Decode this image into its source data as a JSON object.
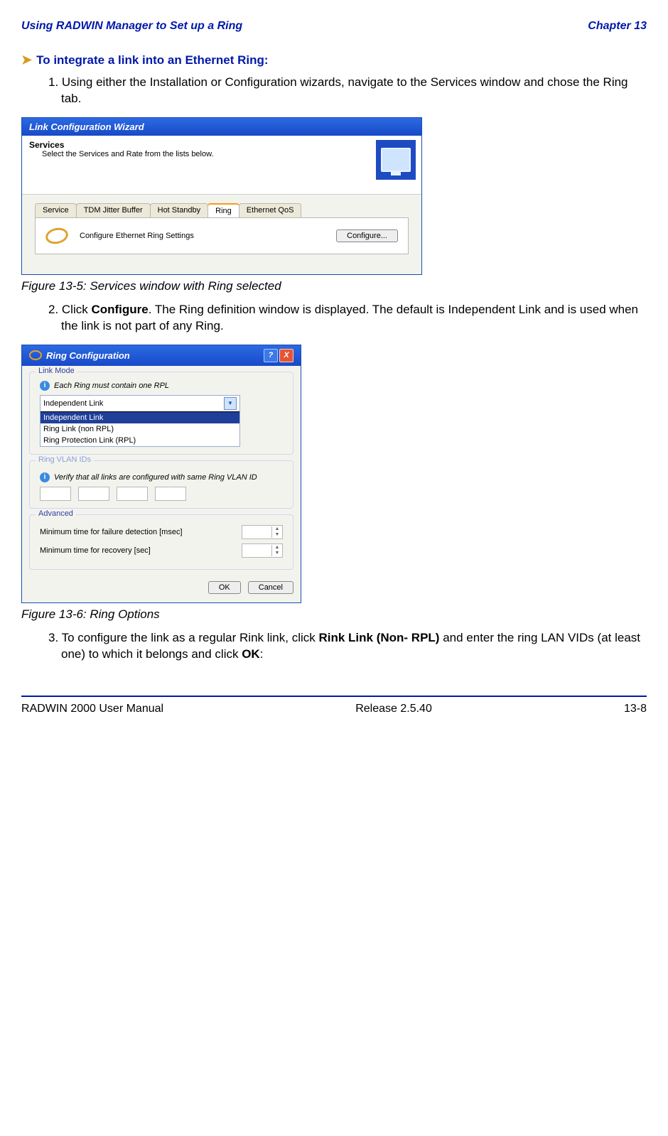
{
  "header": {
    "left": "Using RADWIN Manager to Set up a Ring",
    "right": "Chapter 13"
  },
  "section": {
    "title": "To integrate a link into an Ethernet Ring:"
  },
  "steps": {
    "s1": "1. Using either the Installation or Configuration wizards, navigate to the Services window and chose the Ring tab.",
    "s2": "2. Click Configure. The Ring definition window is displayed. The default is Independent Link and is used when the link is not part of any Ring.",
    "s2_bold": "Configure",
    "s3_pre": "3. To configure the link as a regular Rink link, click ",
    "s3_b1": "Rink Link (Non- RPL)",
    "s3_mid": " and enter the ring LAN VIDs (at least one) to which it belongs and click ",
    "s3_b2": "OK",
    "s3_end": ":"
  },
  "fig": {
    "c1": "Figure 13-5: Services window with Ring selected",
    "c2": "Figure 13-6: Ring Options"
  },
  "wizard": {
    "title": "Link Configuration Wizard",
    "services": "Services",
    "services_sub": "Select the Services and Rate from the lists below.",
    "tabs": {
      "service": "Service",
      "tdm": "TDM Jitter Buffer",
      "hot": "Hot Standby",
      "ring": "Ring",
      "eqos": "Ethernet QoS"
    },
    "pane_text": "Configure Ethernet Ring Settings",
    "configure_btn": "Configure..."
  },
  "dialog": {
    "title": "Ring Configuration",
    "help_icon": "?",
    "close_icon": "X",
    "group_link": "Link Mode",
    "info1": "Each Ring must contain one RPL",
    "combo_selected": "Independent Link",
    "combo_items": {
      "i0": "Independent Link",
      "i1": "Ring Link (non RPL)",
      "i2": "Ring Protection Link (RPL)"
    },
    "group_vlan": "Ring VLAN IDs",
    "info2": "Verify that all links are configured with same Ring VLAN ID",
    "group_adv": "Advanced",
    "adv1": "Minimum time for failure detection [msec]",
    "adv2": "Minimum time for recovery [sec]",
    "ok": "OK",
    "cancel": "Cancel"
  },
  "footer": {
    "left": "RADWIN 2000 User Manual",
    "center": "Release  2.5.40",
    "right": "13-8"
  }
}
